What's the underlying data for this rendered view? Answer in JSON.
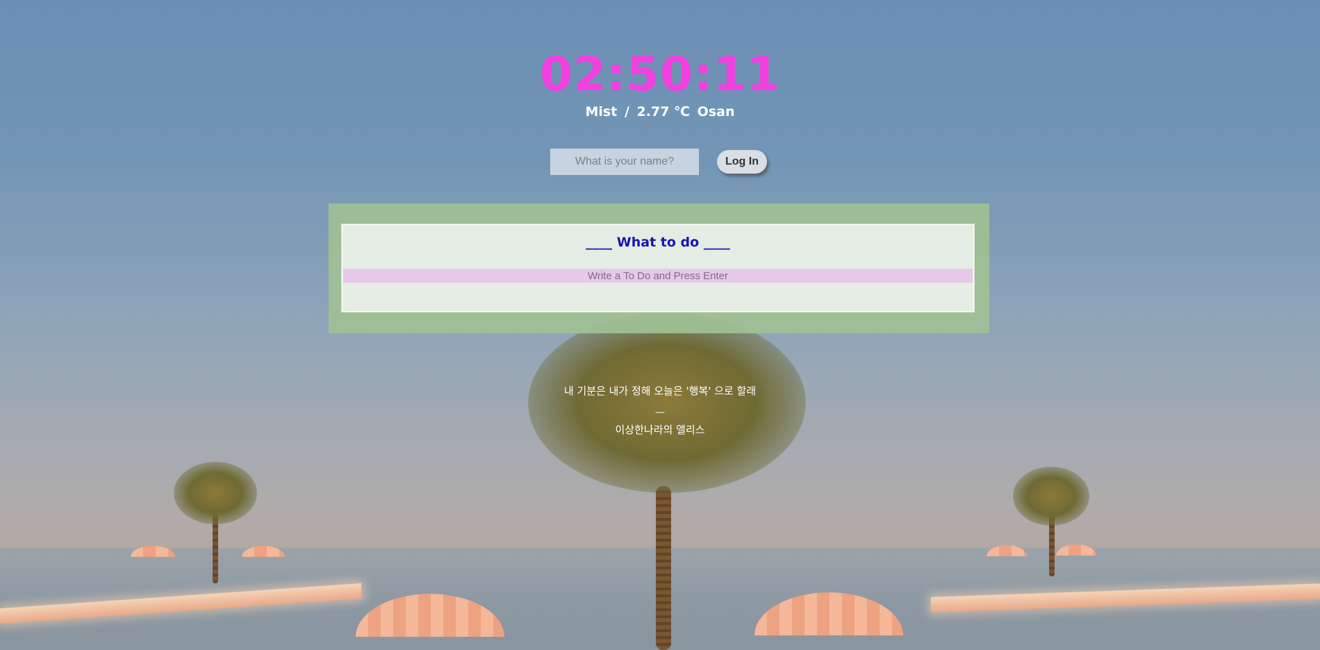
{
  "clock": {
    "time": "02:50:11"
  },
  "weather": {
    "condition": "Mist",
    "separator": "/",
    "temperature": "2.77 ℃",
    "city": "Osan"
  },
  "login": {
    "placeholder": "What is your name?",
    "button_label": "Log In"
  },
  "todo": {
    "title": "____ What to do ____",
    "input_placeholder": "Write a To Do and Press Enter",
    "items": []
  },
  "quote": {
    "text": "내 기분은 내가 정해 오늘은 '행복' 으로 할래",
    "dash": "—",
    "author": "이상한나라의 앨리스"
  },
  "colors": {
    "clock": "#f23fe0",
    "todo_title": "#1a12b5",
    "todo_input_bg": "#e8c8ea",
    "todo_panel": "#a0c094"
  }
}
